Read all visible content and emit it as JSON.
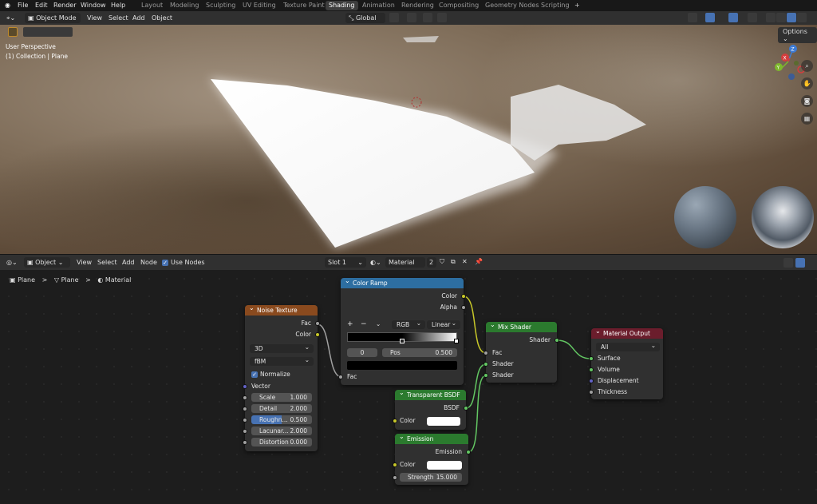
{
  "topbar": {
    "menus": [
      "File",
      "Edit",
      "Render",
      "Window",
      "Help"
    ],
    "workspaces": [
      "Layout",
      "Modeling",
      "Sculpting",
      "UV Editing",
      "Texture Paint",
      "Shading",
      "Animation",
      "Rendering",
      "Compositing",
      "Geometry Nodes",
      "Scripting"
    ],
    "active_workspace": "Shading",
    "add_tab": "+"
  },
  "viewport_header": {
    "mode": "Object Mode",
    "menus": [
      "View",
      "Select",
      "Add",
      "Object"
    ],
    "orientation": "Global",
    "options": "Options"
  },
  "viewport": {
    "perspective": "User Perspective",
    "collection": "(1) Collection | Plane",
    "gizmo_axes": {
      "x": "X",
      "y": "Y",
      "z": "Z"
    }
  },
  "node_header": {
    "editor_type": "Object",
    "menus": [
      "View",
      "Select",
      "Add",
      "Node"
    ],
    "use_nodes_label": "Use Nodes",
    "slot": "Slot 1",
    "material": "Material",
    "user_count": "2"
  },
  "breadcrumb": {
    "items": [
      "Plane",
      "Plane",
      "Material"
    ],
    "separator": ">"
  },
  "nodes": {
    "noise": {
      "title": "Noise Texture",
      "out_fac": "Fac",
      "out_color": "Color",
      "dimensions": "3D",
      "type": "fBM",
      "normalize": "Normalize",
      "vector": "Vector",
      "fields": [
        {
          "label": "Scale",
          "value": "1.000"
        },
        {
          "label": "Detail",
          "value": "2.000"
        },
        {
          "label": "Roughn...",
          "value": "0.500"
        },
        {
          "label": "Lacunar...",
          "value": "2.000"
        },
        {
          "label": "Distortion",
          "value": "0.000"
        }
      ]
    },
    "colorramp": {
      "title": "Color Ramp",
      "out_color": "Color",
      "out_alpha": "Alpha",
      "plus": "+",
      "minus": "−",
      "mode": "RGB",
      "interp": "Linear",
      "index": "0",
      "pos_label": "Pos",
      "pos_value": "0.500",
      "in_fac": "Fac"
    },
    "mix": {
      "title": "Mix Shader",
      "out_shader": "Shader",
      "in_fac": "Fac",
      "in_shader1": "Shader",
      "in_shader2": "Shader"
    },
    "transparent": {
      "title": "Transparent BSDF",
      "out": "BSDF",
      "color": "Color"
    },
    "emission": {
      "title": "Emission",
      "out": "Emission",
      "color": "Color",
      "strength_label": "Strength",
      "strength_value": "15.000"
    },
    "output": {
      "title": "Material Output",
      "target": "All",
      "surface": "Surface",
      "volume": "Volume",
      "displacement": "Displacement",
      "thickness": "Thickness"
    }
  },
  "colors": {
    "noise_header": "#8a4a1e",
    "ramp_header": "#2d6ea1",
    "shader_header": "#2b7a2e",
    "output_header": "#6b1d2c",
    "accent": "#4772b3"
  }
}
